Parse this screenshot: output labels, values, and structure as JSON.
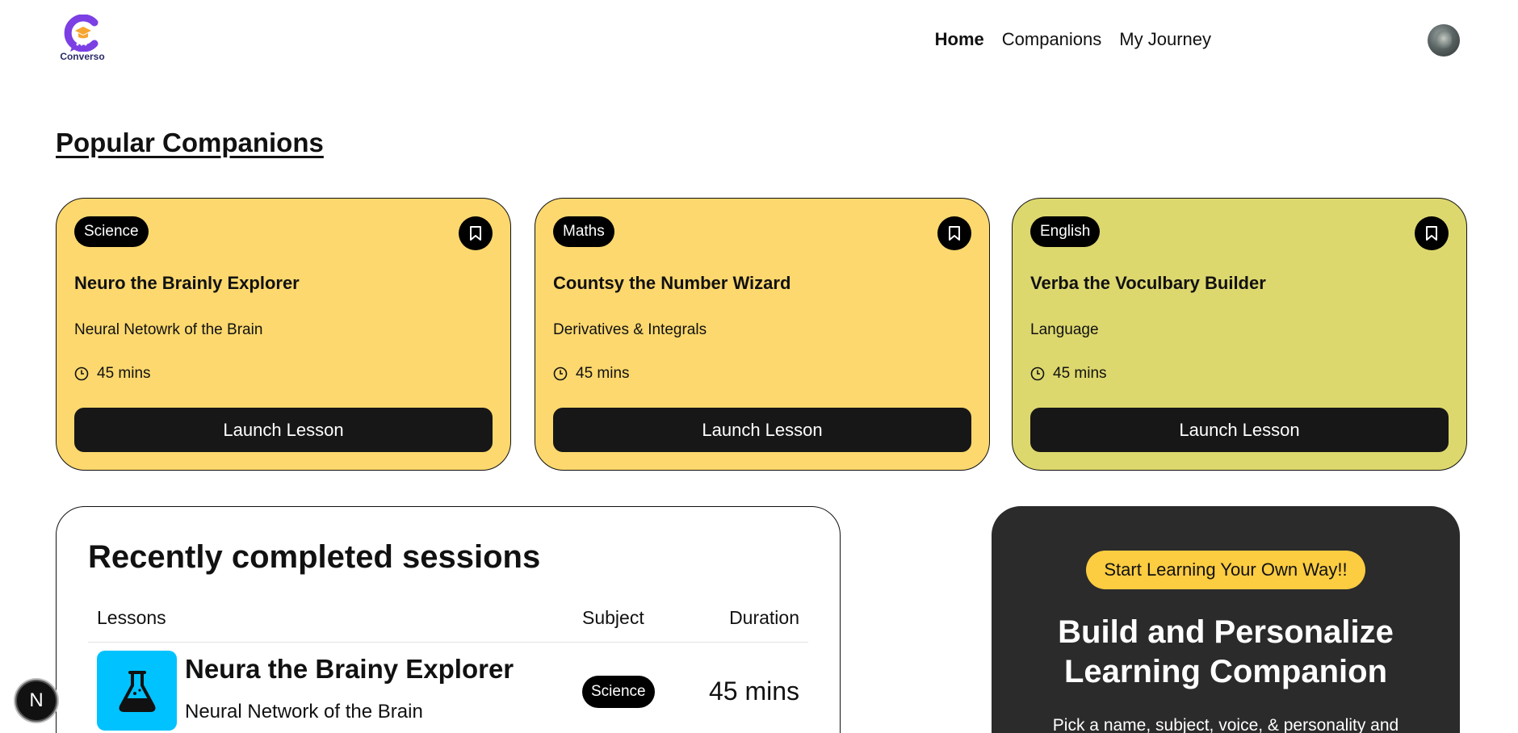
{
  "brand": {
    "name": "Converso",
    "accent": "#7b3fe4"
  },
  "nav": {
    "home": "Home",
    "companions": "Companions",
    "journey": "My Journey"
  },
  "popular": {
    "title": "Popular Companions"
  },
  "cards": [
    {
      "subject": "Science",
      "name": "Neuro the Brainly Explorer",
      "topic": "Neural Netowrk of the Brain",
      "duration": "45 mins",
      "button": "Launch Lesson",
      "color": "#fcd86e",
      "icon": "bookmark-icon"
    },
    {
      "subject": "Maths",
      "name": "Countsy the Number Wizard",
      "topic": "Derivatives & Integrals",
      "duration": "45 mins",
      "button": "Launch Lesson",
      "color": "#fcd86e",
      "icon": "bookmark-icon"
    },
    {
      "subject": "English",
      "name": "Verba the Voculbary Builder",
      "topic": "Language",
      "duration": "45 mins",
      "button": "Launch Lesson",
      "color": "#ddd86e",
      "icon": "bookmark-icon"
    }
  ],
  "recent": {
    "title": "Recently completed sessions",
    "columns": {
      "lessons": "Lessons",
      "subject": "Subject",
      "duration": "Duration"
    },
    "rows": [
      {
        "title": "Neura the Brainy Explorer",
        "topic": "Neural Network of the Brain",
        "subject": "Science",
        "duration": "45 mins",
        "icon": "flask-icon",
        "icon_color": "#00c2ff"
      }
    ]
  },
  "cta": {
    "pill": "Start Learning Your Own Way!!",
    "heading_line1": "Build and Personalize",
    "heading_line2": "Learning Companion",
    "description": "Pick a name, subject, voice, & personality and"
  },
  "fab": {
    "label": "N"
  }
}
